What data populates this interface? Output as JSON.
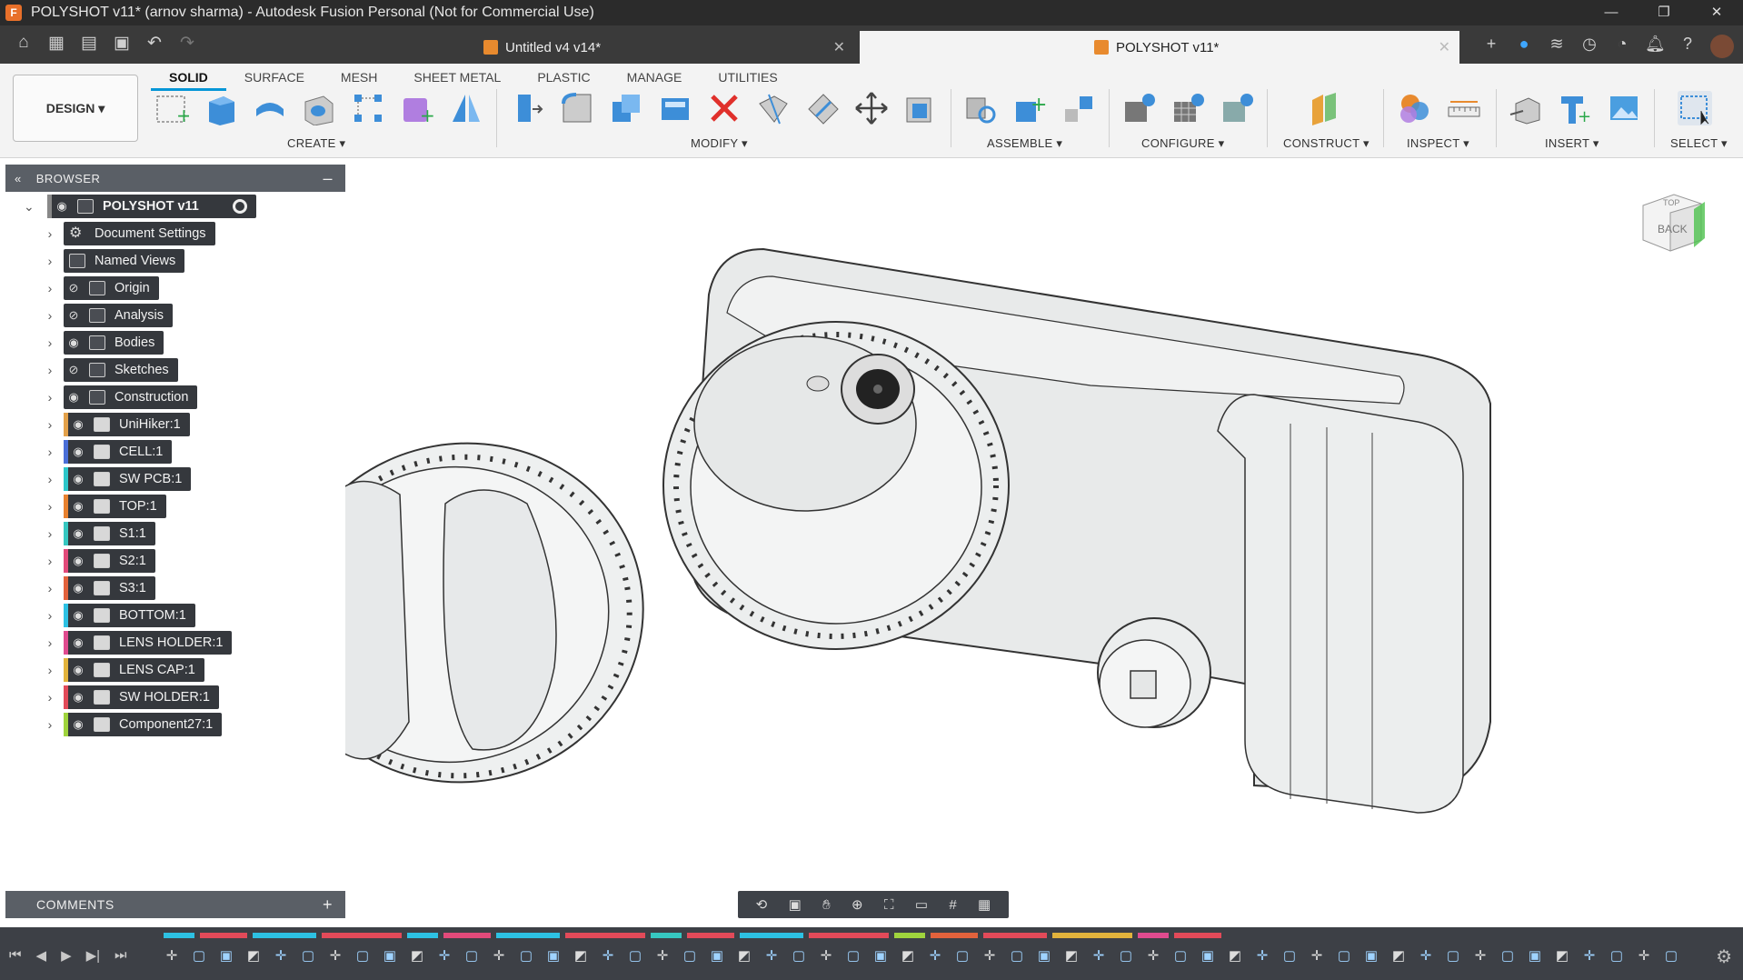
{
  "window": {
    "title": "POLYSHOT v11* (arnov sharma) - Autodesk Fusion Personal (Not for Commercial Use)",
    "controls": [
      "—",
      "❐",
      "✕"
    ]
  },
  "tabs": [
    {
      "label": "Untitled v4 v14*",
      "active": false
    },
    {
      "label": "POLYSHOT v11*",
      "active": true
    }
  ],
  "quick_access": [
    "home-icon",
    "grid-icon",
    "file-icon",
    "save-icon",
    "undo-icon",
    "redo-icon"
  ],
  "workspace": {
    "label": "DESIGN ▾"
  },
  "toolbar_tabs": [
    "SOLID",
    "SURFACE",
    "MESH",
    "SHEET METAL",
    "PLASTIC",
    "MANAGE",
    "UTILITIES"
  ],
  "toolbar_groups": [
    {
      "name": "CREATE ▾",
      "tools": [
        "create-sketch-icon",
        "extrude-icon",
        "revolve-icon",
        "hole-icon",
        "pattern-icon",
        "new-component-icon",
        "mirror-icon"
      ]
    },
    {
      "name": "MODIFY ▾",
      "tools": [
        "press-pull-icon",
        "fillet-icon",
        "combine-icon",
        "shell-icon",
        "delete-icon",
        "split-body-icon",
        "split-face-icon",
        "move-icon",
        "scale-icon"
      ]
    },
    {
      "name": "ASSEMBLE ▾",
      "tools": [
        "joint-icon",
        "new-component-icon",
        "as-built-joint-icon"
      ]
    },
    {
      "name": "CONFIGURE ▾",
      "tools": [
        "configure-icon",
        "table-icon",
        "theme-icon"
      ]
    },
    {
      "name": "CONSTRUCT ▾",
      "tools": [
        "offset-plane-icon"
      ]
    },
    {
      "name": "INSPECT ▾",
      "tools": [
        "display-component-colors-icon",
        "measure-icon"
      ]
    },
    {
      "name": "INSERT ▾",
      "tools": [
        "insert-derive-icon",
        "insert-mcmaster-icon",
        "insert-canvas-icon"
      ]
    },
    {
      "name": "SELECT ▾",
      "tools": [
        "select-window-icon"
      ]
    }
  ],
  "browser": {
    "title": "BROWSER",
    "root": "POLYSHOT v11",
    "items": [
      {
        "label": "Document Settings",
        "type": "settings",
        "visible": null
      },
      {
        "label": "Named Views",
        "type": "folder",
        "visible": null
      },
      {
        "label": "Origin",
        "type": "folder",
        "visible": false
      },
      {
        "label": "Analysis",
        "type": "folder",
        "visible": false
      },
      {
        "label": "Bodies",
        "type": "folder",
        "visible": true
      },
      {
        "label": "Sketches",
        "type": "folder",
        "visible": false
      },
      {
        "label": "Construction",
        "type": "folder",
        "visible": true
      },
      {
        "label": "UniHiker:1",
        "type": "component",
        "color": "#e3a14a"
      },
      {
        "label": "CELL:1",
        "type": "component",
        "color": "#4a6fd8"
      },
      {
        "label": "SW PCB:1",
        "type": "component",
        "color": "#2cc6c9"
      },
      {
        "label": "TOP:1",
        "type": "component",
        "color": "#e8812f"
      },
      {
        "label": "S1:1",
        "type": "component",
        "color": "#36c7c0"
      },
      {
        "label": "S2:1",
        "type": "component",
        "color": "#e24a7a"
      },
      {
        "label": "S3:1",
        "type": "component",
        "color": "#e2623c"
      },
      {
        "label": "BOTTOM:1",
        "type": "component",
        "color": "#2dc1e3"
      },
      {
        "label": "LENS HOLDER:1",
        "type": "component",
        "color": "#e04b8f"
      },
      {
        "label": "LENS CAP:1",
        "type": "component",
        "color": "#e2b33c"
      },
      {
        "label": "SW HOLDER:1",
        "type": "component",
        "color": "#e24a59"
      },
      {
        "label": "Component27:1",
        "type": "component",
        "color": "#9fd43d"
      }
    ]
  },
  "comments": {
    "title": "COMMENTS"
  },
  "viewcube": {
    "top": "TOP",
    "front": "BACK",
    "axis": "X"
  },
  "navbar": [
    "orbit-icon",
    "look-at-icon",
    "pan-icon",
    "zoom-icon",
    "fit-icon",
    "display-settings-icon",
    "grid-icon",
    "viewports-icon"
  ],
  "timeline": {
    "controls": [
      "⏮",
      "◀",
      "▶",
      "▶|",
      "⏭"
    ]
  }
}
